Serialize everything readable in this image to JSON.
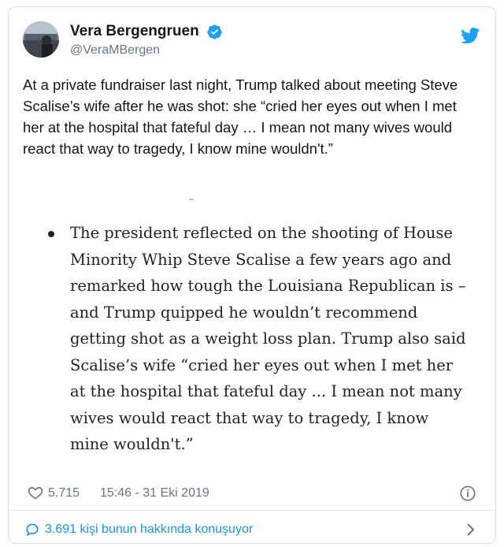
{
  "tweet": {
    "author": {
      "name": "Vera Bergengruen",
      "handle": "@VeraMBergen",
      "verified": true
    },
    "text": "At a private fundraiser last night, Trump talked about meeting Steve Scalise’s wife after he was shot: she “cried her eyes out when I met her at the hospital that fateful day … I mean not many wives would react that way to tragedy, I know mine wouldn't.”",
    "quote": {
      "text": "The president reflected on the shooting of House Minority Whip Steve Scalise a few years ago and remarked how tough the Louisiana Republican is – and Trump quipped he wouldn’t recommend getting shot as a weight loss plan. Trump also said Scalise’s wife “cried her eyes out when I met her at the hospital that fateful day ... I mean not many wives would react that way to tragedy, I know mine wouldn't.”"
    },
    "likes": "5.715",
    "timestamp": "15:46 - 31 Eki 2019",
    "conversation": "3.691 kişi bunun hakkında konuşuyor"
  },
  "icons": {
    "logo": "twitter-bird-icon",
    "verified": "verified-badge-icon",
    "like": "heart-icon",
    "info": "info-icon",
    "reply": "speech-bubble-icon",
    "chevron": "chevron-right-icon"
  },
  "colors": {
    "brand": "#1da1f2",
    "link": "#1b95e0",
    "text": "#14171a",
    "muted": "#657786"
  }
}
